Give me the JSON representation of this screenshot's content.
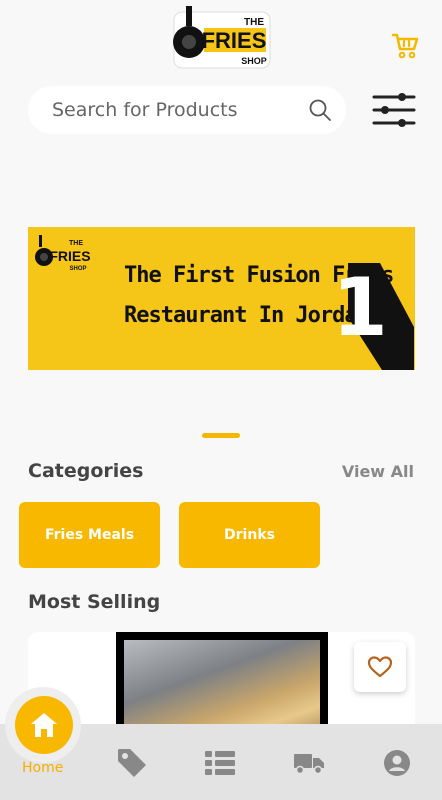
{
  "header": {
    "logo": {
      "the": "THE",
      "brand": "FRIES",
      "shop": "SHOP"
    },
    "cart_icon": "cart-icon"
  },
  "search": {
    "placeholder": "Search for Products",
    "icon": "search-icon"
  },
  "filter_icon": "sliders-icon",
  "banner": {
    "line1": "The First Fusion Fries",
    "line2": "Restaurant In Jordan",
    "number": "1"
  },
  "categories": {
    "title": "Categories",
    "view_all": "View All",
    "items": [
      {
        "label": "Fries Meals"
      },
      {
        "label": "Drinks"
      }
    ]
  },
  "most_selling": {
    "title": "Most Selling"
  },
  "bottom_nav": {
    "home_label": "Home",
    "items": [
      "home-icon",
      "tag-icon",
      "list-icon",
      "truck-icon",
      "account-icon"
    ]
  },
  "colors": {
    "accent": "#f9b800",
    "background": "#f8f8f8",
    "banner": "#f5c518"
  }
}
